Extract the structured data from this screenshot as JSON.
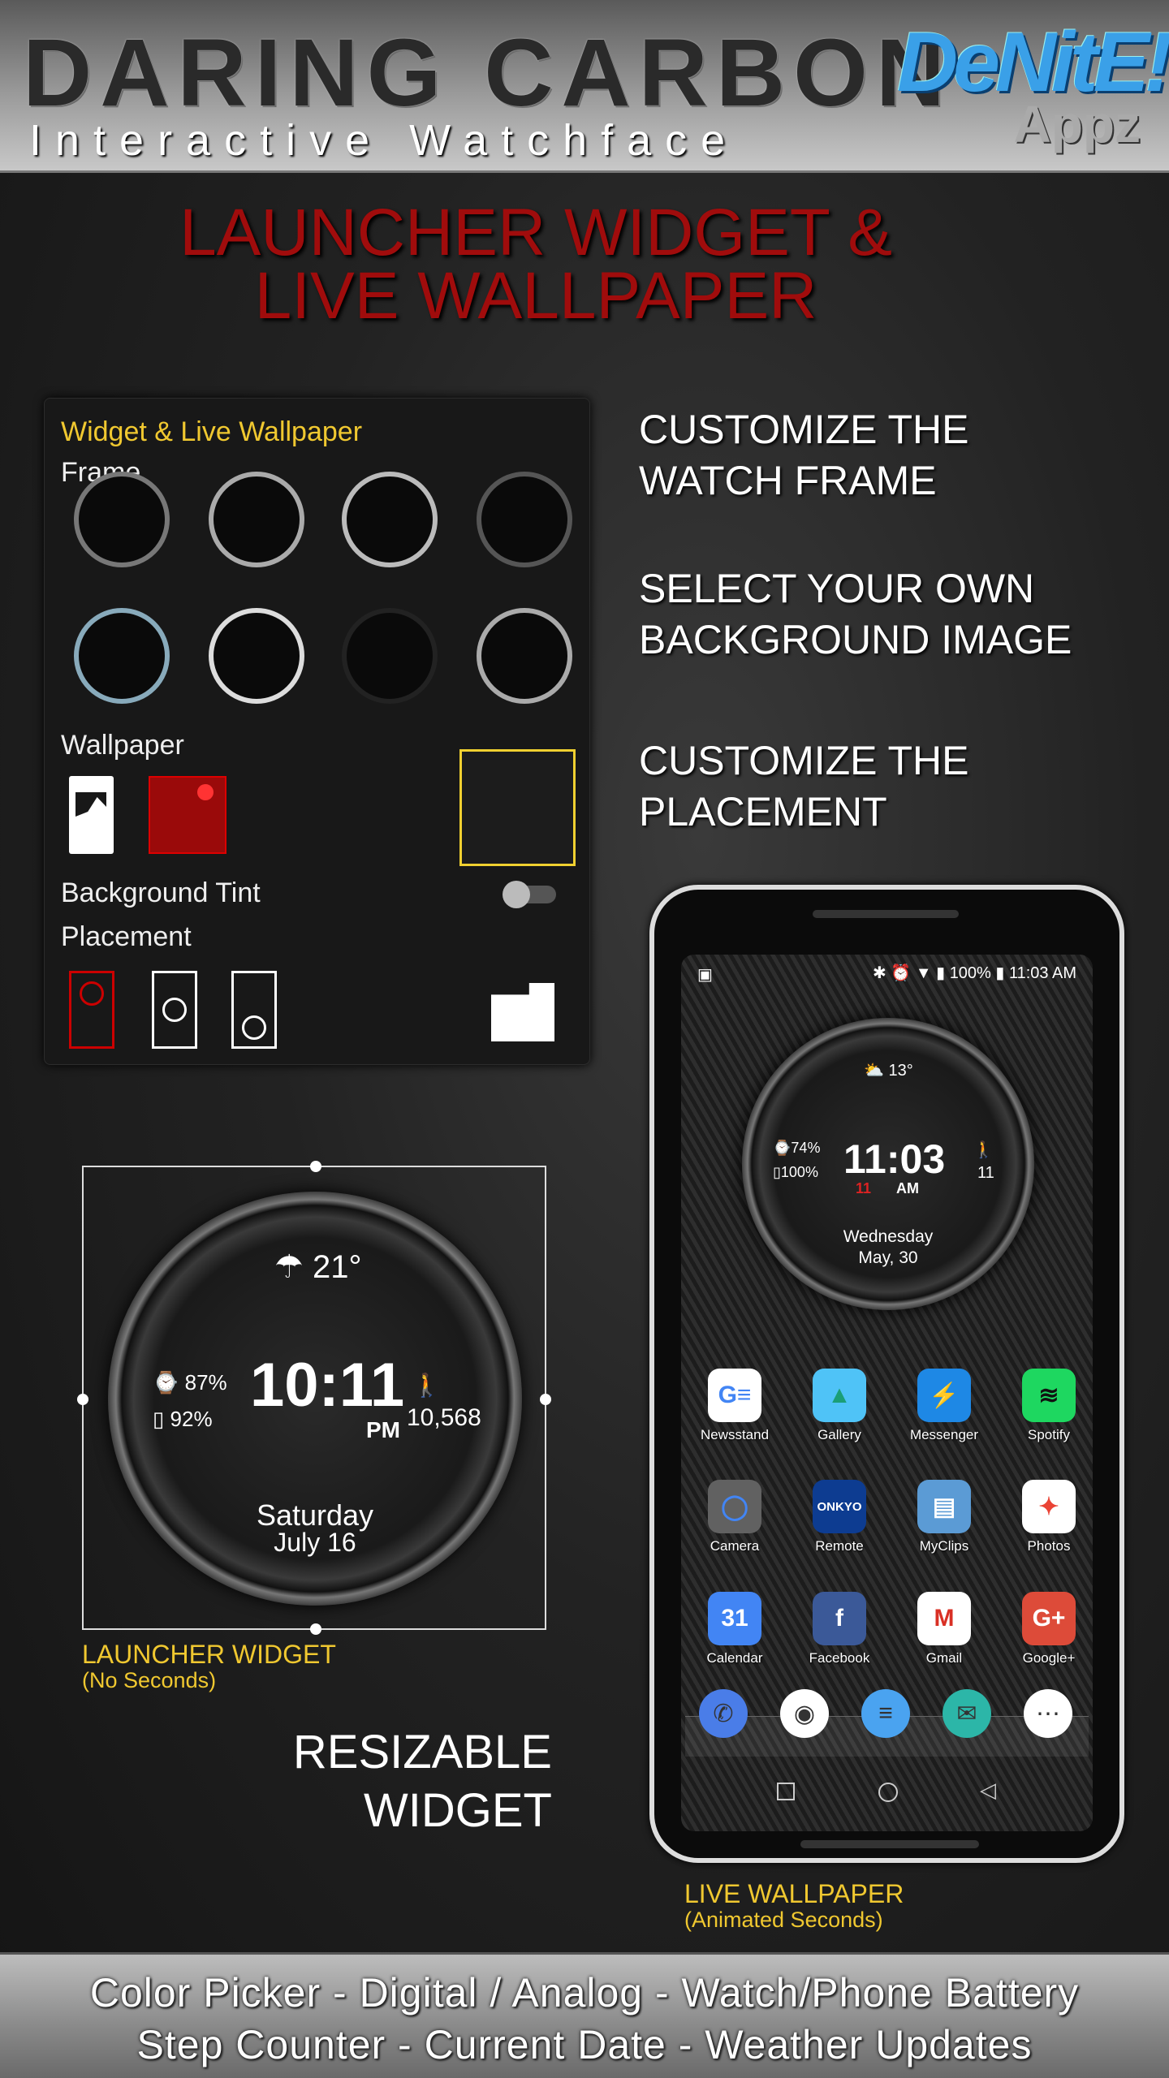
{
  "header": {
    "title": "DARING CARBON",
    "subtitle": "Interactive Watchface",
    "logo_text": "DeNitE! Appz",
    "logo_main": "DeNitE!",
    "logo_sub": "Appz"
  },
  "headline": {
    "line1": "LAUNCHER WIDGET &",
    "line2": "LIVE WALLPAPER",
    "color": "#a00c0c"
  },
  "settings_panel": {
    "title": "Widget & Live Wallpaper",
    "frame_label": "Frame",
    "frame_count": 8,
    "wallpaper_label": "Wallpaper",
    "background_tint_label": "Background Tint",
    "background_tint_on": false,
    "placement_label": "Placement"
  },
  "features": [
    {
      "l1": "CUSTOMIZE THE",
      "l2": "WATCH FRAME"
    },
    {
      "l1": "SELECT YOUR OWN",
      "l2": "BACKGROUND IMAGE"
    },
    {
      "l1": "CUSTOMIZE THE",
      "l2": "PLACEMENT"
    }
  ],
  "widget": {
    "weather": "21°",
    "watch_battery": "87%",
    "phone_battery": "92%",
    "time": "10:11",
    "ampm": "PM",
    "steps": "10,568",
    "day": "Saturday",
    "date": "July 16",
    "caption": "LAUNCHER WIDGET",
    "caption_sub": "(No Seconds)"
  },
  "resizable": {
    "l1": "RESIZABLE",
    "l2": "WIDGET"
  },
  "phone": {
    "status": {
      "battery": "100%",
      "time": "11:03 AM"
    },
    "watch": {
      "weather": "13°",
      "watch_battery": "74%",
      "phone_battery": "100%",
      "time": "11:03",
      "seconds": "11",
      "ampm": "AM",
      "steps": "11",
      "day": "Wednesday",
      "date": "May, 30"
    },
    "apps": [
      {
        "label": "Newsstand",
        "glyph": "G≡",
        "bg": "#ffffff",
        "fg": "#4285f4"
      },
      {
        "label": "Gallery",
        "glyph": "▲",
        "bg": "#4fc3f7",
        "fg": "#1b9e77"
      },
      {
        "label": "Messenger",
        "glyph": "⚡",
        "bg": "#1e88e5",
        "fg": "#ffffff"
      },
      {
        "label": "Spotify",
        "glyph": "≋",
        "bg": "#1ed760",
        "fg": "#111111"
      },
      {
        "label": "Camera",
        "glyph": "◯",
        "bg": "#616161",
        "fg": "#4285f4"
      },
      {
        "label": "Remote",
        "glyph": "ONKYO",
        "bg": "#0d3c91",
        "fg": "#ffffff"
      },
      {
        "label": "MyClips",
        "glyph": "▤",
        "bg": "#5b9bd5",
        "fg": "#ffffff"
      },
      {
        "label": "Photos",
        "glyph": "✦",
        "bg": "#ffffff",
        "fg": "#ea4335"
      },
      {
        "label": "Calendar",
        "glyph": "31",
        "bg": "#4285f4",
        "fg": "#ffffff"
      },
      {
        "label": "Facebook",
        "glyph": "f",
        "bg": "#3b5998",
        "fg": "#ffffff"
      },
      {
        "label": "Gmail",
        "glyph": "M",
        "bg": "#ffffff",
        "fg": "#d93025"
      },
      {
        "label": "Google+",
        "glyph": "G+",
        "bg": "#dd4b39",
        "fg": "#ffffff"
      }
    ],
    "dock": [
      {
        "name": "phone",
        "glyph": "✆",
        "bg": "#4a7de8"
      },
      {
        "name": "chrome",
        "glyph": "◉",
        "bg": "#ffffff"
      },
      {
        "name": "messages",
        "glyph": "≡",
        "bg": "#4aa3f0"
      },
      {
        "name": "email",
        "glyph": "✉",
        "bg": "#2cb6a8"
      },
      {
        "name": "app-drawer",
        "glyph": "⋯",
        "bg": "#ffffff"
      }
    ],
    "caption": "LIVE WALLPAPER",
    "caption_sub": "(Animated Seconds)"
  },
  "footer": {
    "line1": "Color Picker - Digital / Analog - Watch/Phone Battery",
    "line2": "Step Counter - Current Date - Weather Updates"
  },
  "accent_colors": {
    "yellow": "#f0c830",
    "red": "#a00c0c"
  }
}
